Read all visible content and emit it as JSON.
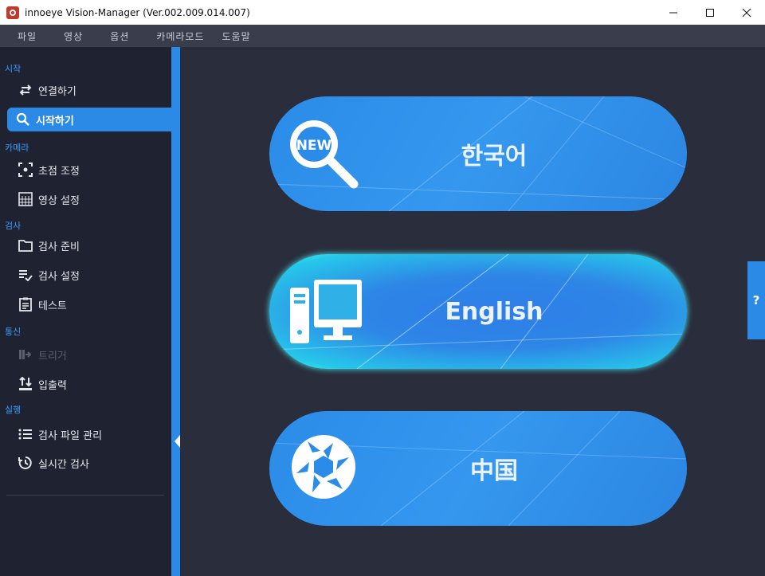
{
  "window": {
    "title": "innoeye Vision-Manager (Ver.002.009.014.007)"
  },
  "menu": [
    "파일",
    "영상",
    "옵션",
    "카메라모드",
    "도움말"
  ],
  "sidebar": {
    "sections": {
      "start": "시작",
      "camera": "카메라",
      "inspect": "검사",
      "comm": "통신",
      "run": "실행"
    },
    "items": {
      "connect": "연결하기",
      "start": "시작하기",
      "focus": "초점 조정",
      "image_settings": "영상 설정",
      "inspect_prep": "검사 준비",
      "inspect_settings": "검사 설정",
      "test": "테스트",
      "trigger": "트리거",
      "io": "입출력",
      "file_manage": "검사 파일 관리",
      "realtime": "실시간 검사"
    }
  },
  "languages": {
    "korean": {
      "label": "한국어",
      "icon": "new-search-icon"
    },
    "english": {
      "label": "English",
      "icon": "computer-icon"
    },
    "chinese": {
      "label": "中国",
      "icon": "aperture-icon"
    }
  },
  "help": {
    "label": "?"
  },
  "colors": {
    "accent": "#2b8ae6",
    "sidebar": "#1f2230",
    "background": "#2a2d3b",
    "section": "#3b9bff"
  }
}
